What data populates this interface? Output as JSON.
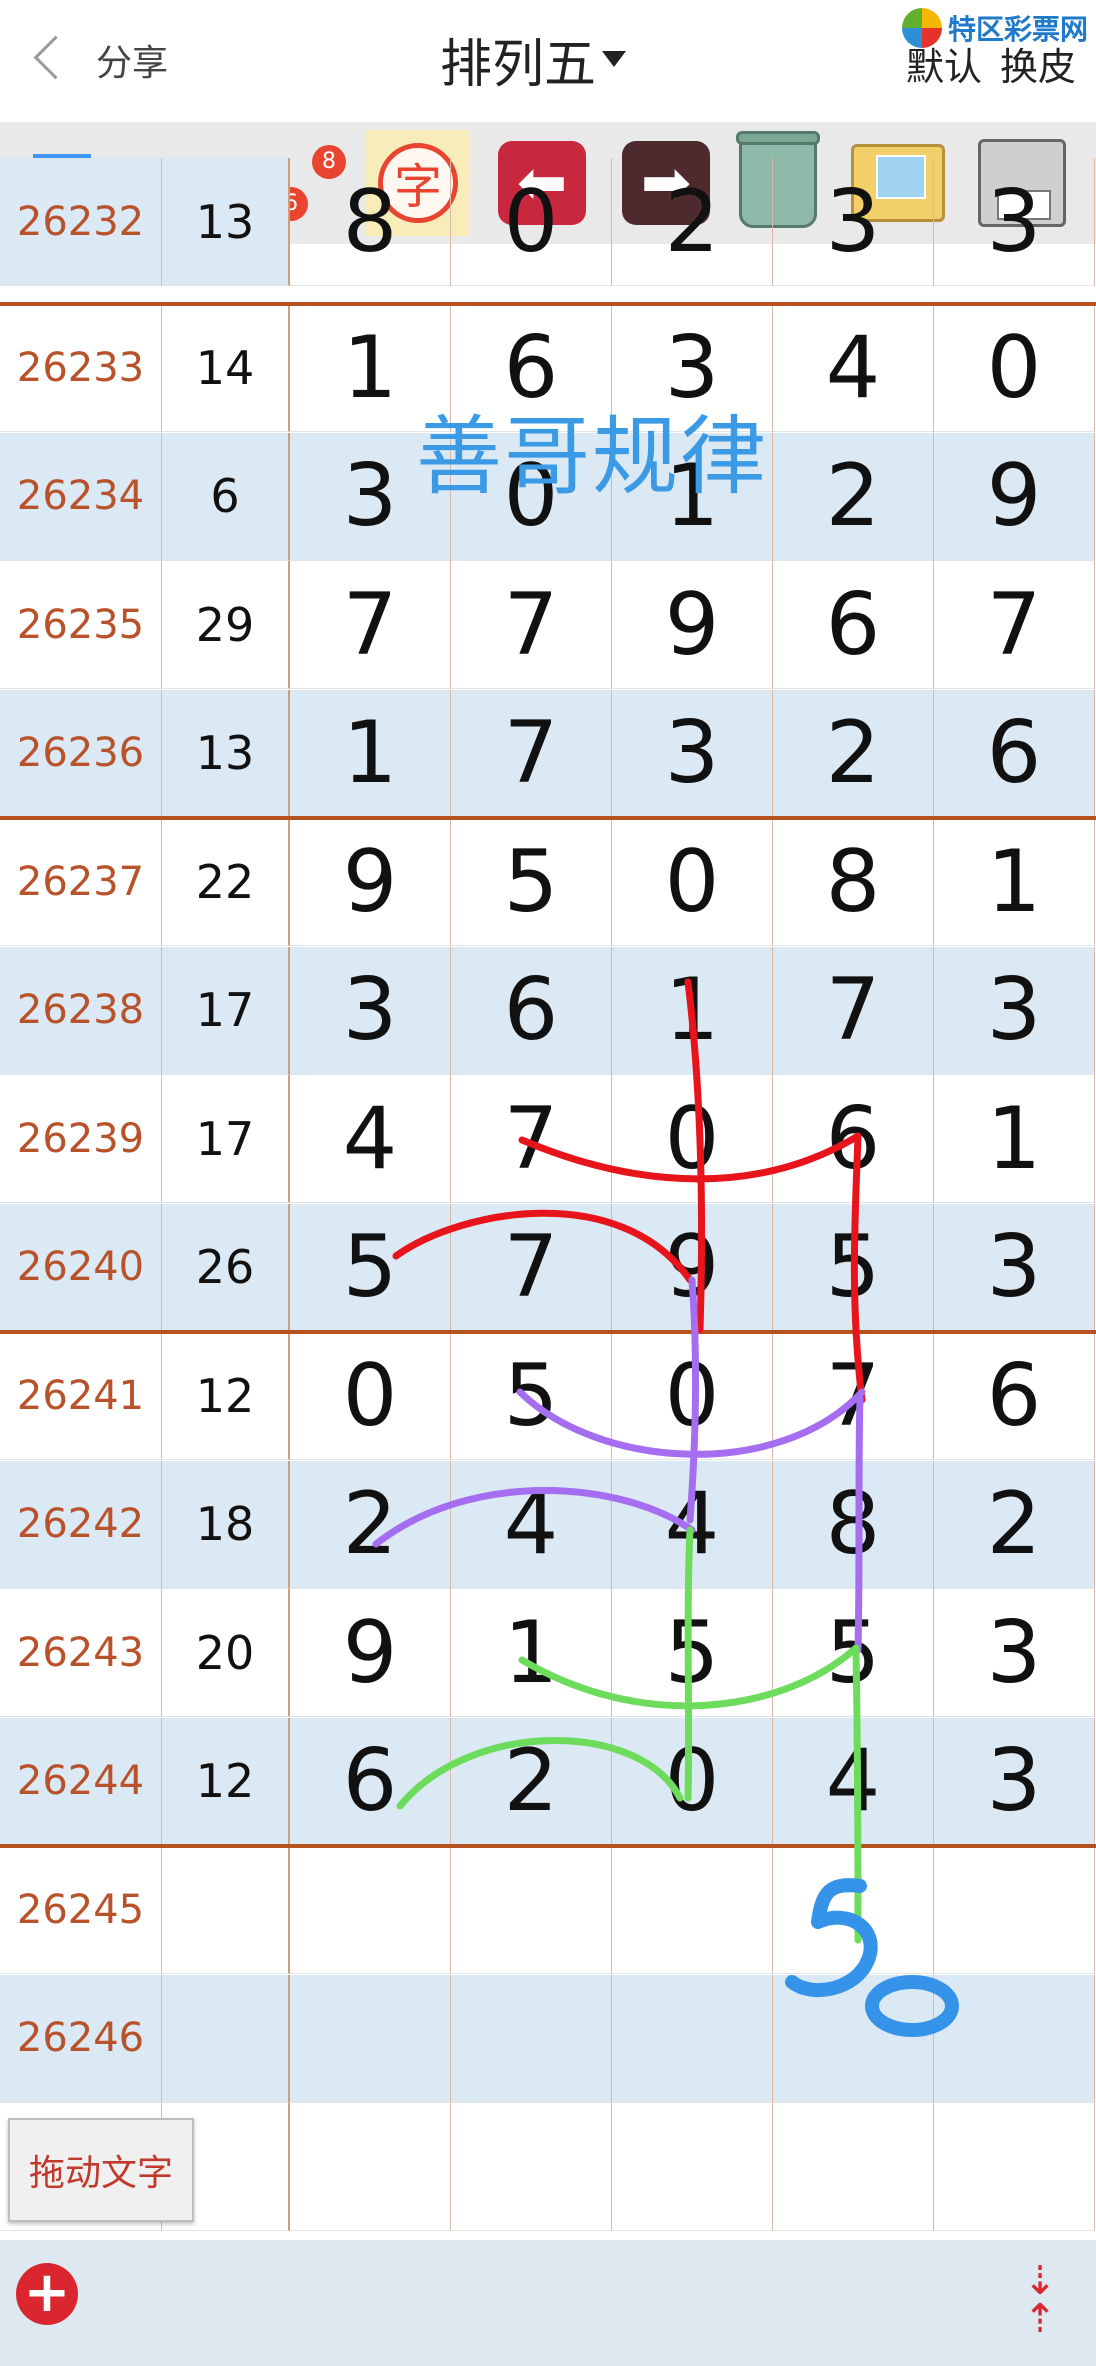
{
  "header": {
    "share_label": "分享",
    "title": "排列五",
    "actions": [
      "默认",
      "换皮"
    ],
    "logo_text": "特区彩票网"
  },
  "toolbar": {
    "tools": [
      "color-square",
      "pen",
      "number-8-6",
      "字",
      "undo",
      "redo",
      "trash",
      "photo",
      "save"
    ],
    "num_top": "8",
    "num_bottom": "6",
    "zi_label": "字"
  },
  "rows": [
    {
      "id": "26233",
      "sum": "14",
      "digits": [
        "1",
        "6",
        "3",
        "4",
        "0"
      ]
    },
    {
      "id": "26234",
      "sum": "6",
      "digits": [
        "3",
        "0",
        "1",
        "2",
        "9"
      ]
    },
    {
      "id": "26235",
      "sum": "29",
      "digits": [
        "7",
        "7",
        "9",
        "6",
        "7"
      ]
    },
    {
      "id": "26236",
      "sum": "13",
      "digits": [
        "1",
        "7",
        "3",
        "2",
        "6"
      ]
    },
    {
      "id": "26237",
      "sum": "22",
      "digits": [
        "9",
        "5",
        "0",
        "8",
        "1"
      ]
    },
    {
      "id": "26238",
      "sum": "17",
      "digits": [
        "3",
        "6",
        "1",
        "7",
        "3"
      ]
    },
    {
      "id": "26239",
      "sum": "17",
      "digits": [
        "4",
        "7",
        "0",
        "6",
        "1"
      ]
    },
    {
      "id": "26240",
      "sum": "26",
      "digits": [
        "5",
        "7",
        "9",
        "5",
        "3"
      ]
    },
    {
      "id": "26241",
      "sum": "12",
      "digits": [
        "0",
        "5",
        "0",
        "7",
        "6"
      ]
    },
    {
      "id": "26242",
      "sum": "18",
      "digits": [
        "2",
        "4",
        "4",
        "8",
        "2"
      ]
    },
    {
      "id": "26243",
      "sum": "20",
      "digits": [
        "9",
        "1",
        "5",
        "5",
        "3"
      ]
    },
    {
      "id": "26244",
      "sum": "12",
      "digits": [
        "6",
        "2",
        "0",
        "4",
        "3"
      ]
    },
    {
      "id": "26245",
      "sum": "",
      "digits": [
        "",
        "",
        "",
        "",
        ""
      ]
    },
    {
      "id": "26246",
      "sum": "",
      "digits": [
        "",
        "",
        "",
        "",
        ""
      ]
    },
    {
      "id": "",
      "sum": "",
      "digits": [
        "",
        "",
        "",
        "",
        ""
      ]
    }
  ],
  "partial_top_row": {
    "id": "26232",
    "sum": "13",
    "digits": [
      "8",
      "0",
      "2",
      "3",
      "3"
    ]
  },
  "watermark": "善哥规律",
  "handwriting": "50",
  "drag_button_label": "拖动文字",
  "colors": {
    "accent_blue": "#3d97f0",
    "id_text": "#b8522a",
    "separator": "#b5521f",
    "alt_row": "#dbe9f4",
    "stroke_red": "#e8141b",
    "stroke_purple": "#a56ef0",
    "stroke_green": "#6ddb5b",
    "stroke_blue": "#3594ea"
  }
}
